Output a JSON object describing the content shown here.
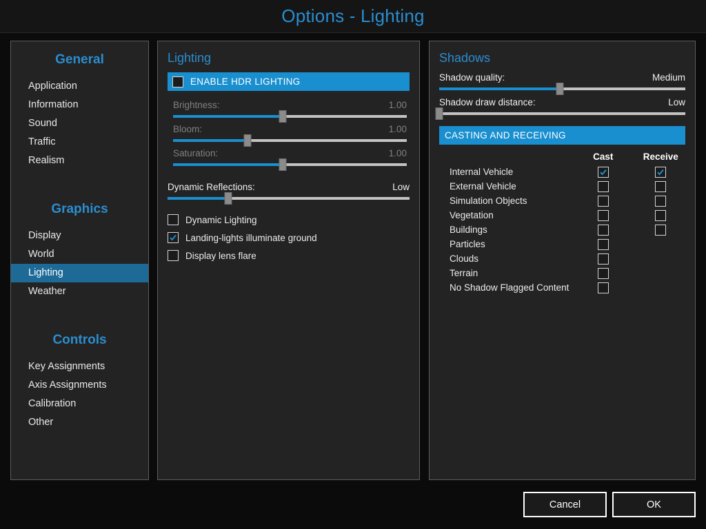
{
  "window": {
    "title": "Options - Lighting"
  },
  "accent": {
    "blue": "#1a8fd0",
    "title_blue": "#2b8dd0",
    "selected_blue": "#1d6a97"
  },
  "sidebar": {
    "groups": [
      {
        "title": "General",
        "items": [
          {
            "label": "Application",
            "selected": false
          },
          {
            "label": "Information",
            "selected": false
          },
          {
            "label": "Sound",
            "selected": false
          },
          {
            "label": "Traffic",
            "selected": false
          },
          {
            "label": "Realism",
            "selected": false
          }
        ]
      },
      {
        "title": "Graphics",
        "items": [
          {
            "label": "Display",
            "selected": false
          },
          {
            "label": "World",
            "selected": false
          },
          {
            "label": "Lighting",
            "selected": true
          },
          {
            "label": "Weather",
            "selected": false
          }
        ]
      },
      {
        "title": "Controls",
        "items": [
          {
            "label": "Key Assignments",
            "selected": false
          },
          {
            "label": "Axis Assignments",
            "selected": false
          },
          {
            "label": "Calibration",
            "selected": false
          },
          {
            "label": "Other",
            "selected": false
          }
        ]
      }
    ]
  },
  "lighting": {
    "heading": "Lighting",
    "hdr_bar": {
      "label": "ENABLE HDR LIGHTING",
      "checked": false
    },
    "sliders": [
      {
        "name": "Brightness:",
        "value": "1.00",
        "percent": 47,
        "disabled": true
      },
      {
        "name": "Bloom:",
        "value": "1.00",
        "percent": 32,
        "disabled": true
      },
      {
        "name": "Saturation:",
        "value": "1.00",
        "percent": 47,
        "disabled": true
      }
    ],
    "reflections": {
      "name": "Dynamic Reflections:",
      "value": "Low",
      "percent": 25,
      "disabled": false
    },
    "checkboxes": [
      {
        "label": "Dynamic Lighting",
        "checked": false
      },
      {
        "label": "Landing-lights illuminate ground",
        "checked": true
      },
      {
        "label": "Display lens flare",
        "checked": false
      }
    ]
  },
  "shadows": {
    "heading": "Shadows",
    "sliders": [
      {
        "name": "Shadow quality:",
        "value": "Medium",
        "percent": 49,
        "disabled": false
      },
      {
        "name": "Shadow draw distance:",
        "value": "Low",
        "percent": 0,
        "disabled": false
      }
    ],
    "section_bar": "CASTING AND RECEIVING",
    "columns": {
      "cast": "Cast",
      "receive": "Receive"
    },
    "rows": [
      {
        "label": "Internal Vehicle",
        "cast": true,
        "receive": true,
        "has_receive": true
      },
      {
        "label": "External Vehicle",
        "cast": false,
        "receive": false,
        "has_receive": true
      },
      {
        "label": "Simulation Objects",
        "cast": false,
        "receive": false,
        "has_receive": true
      },
      {
        "label": "Vegetation",
        "cast": false,
        "receive": false,
        "has_receive": true
      },
      {
        "label": "Buildings",
        "cast": false,
        "receive": false,
        "has_receive": true
      },
      {
        "label": "Particles",
        "cast": false,
        "receive": false,
        "has_receive": false
      },
      {
        "label": "Clouds",
        "cast": false,
        "receive": false,
        "has_receive": false
      },
      {
        "label": "Terrain",
        "cast": false,
        "receive": false,
        "has_receive": false
      },
      {
        "label": "No Shadow Flagged Content",
        "cast": false,
        "receive": false,
        "has_receive": false
      }
    ]
  },
  "footer": {
    "cancel": "Cancel",
    "ok": "OK"
  }
}
